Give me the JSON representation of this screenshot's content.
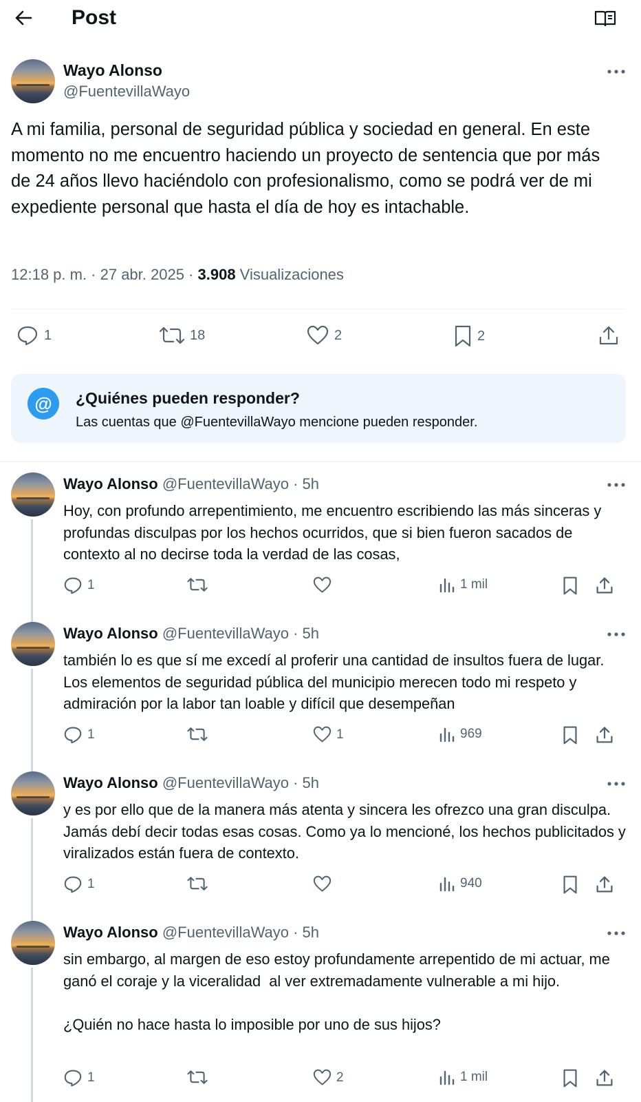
{
  "header": {
    "title": "Post"
  },
  "main_post": {
    "name": "Wayo Alonso",
    "handle": "@FuentevillaWayo",
    "text": "A mi familia, personal de seguridad pública y sociedad en general. En este momento no me encuentro haciendo un proyecto de sentencia que por más de 24 años llevo haciéndolo con profesionalismo, como se podrá ver de mi expediente personal que hasta el día de hoy es intachable.",
    "time": "12:18 p. m. · 27 abr. 2025 · ",
    "views": "3.908",
    "views_label": " Visualizaciones",
    "stats": {
      "replies": "1",
      "reposts": "18",
      "likes": "2",
      "bookmarks": "2"
    }
  },
  "reply_card": {
    "icon": "@",
    "title": "¿Quiénes pueden responder?",
    "subtitle": "Las cuentas que @FuentevillaWayo mencione pueden responder."
  },
  "replies": [
    {
      "name": "Wayo Alonso",
      "handle": "@FuentevillaWayo · 5h",
      "text": "Hoy, con profundo arrepentimiento, me encuentro escribiendo las más sinceras y profundas disculpas por los hechos ocurridos, que si bien fueron sacados de contexto al no decirse toda la verdad de las cosas,",
      "replies": "1",
      "reposts": "",
      "likes": "",
      "views": "1 mil"
    },
    {
      "name": "Wayo Alonso",
      "handle": "@FuentevillaWayo · 5h",
      "text": "también lo es que sí me excedí al proferir una cantidad de insultos fuera de lugar. Los elementos de seguridad pública del municipio merecen todo mi respeto y admiración por la labor tan loable y difícil que desempeñan",
      "replies": "1",
      "reposts": "",
      "likes": "1",
      "views": "969"
    },
    {
      "name": "Wayo Alonso",
      "handle": "@FuentevillaWayo · 5h",
      "text": "y es por ello que de la manera más atenta y sincera les ofrezco una gran disculpa. Jamás debí decir todas esas cosas. Como ya lo mencioné, los hechos publicitados y viralizados están fuera de contexto.",
      "replies": "1",
      "reposts": "",
      "likes": "",
      "views": "940"
    },
    {
      "name": "Wayo Alonso",
      "handle": "@FuentevillaWayo · 5h",
      "text": "sin embargo, al margen de eso estoy profundamente arrepentido de mi actuar, me ganó el coraje y la viceralidad  al ver extremadamente vulnerable a mi hijo.\n\n¿Quién no hace hasta lo imposible por uno de sus hijos?",
      "replies": "1",
      "reposts": "",
      "likes": "2",
      "views": "1 mil"
    }
  ],
  "colors": {
    "accent": "#1d9bf0",
    "secondary_text": "#536471",
    "card_bg": "#eef5fc"
  }
}
